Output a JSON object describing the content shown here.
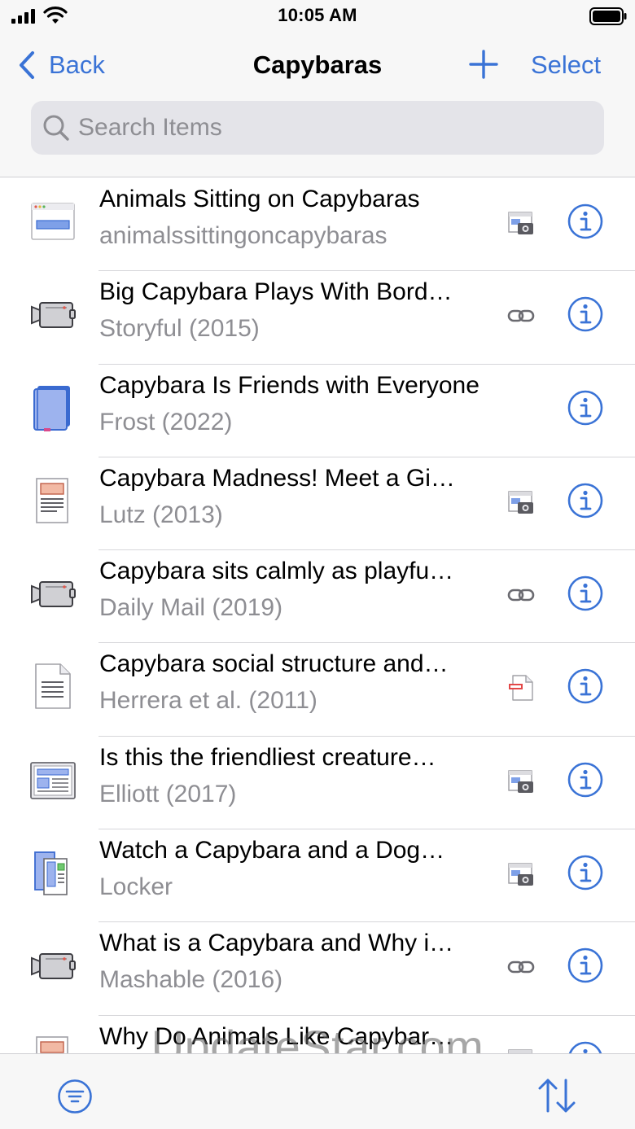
{
  "status_bar": {
    "time": "10:05 AM"
  },
  "nav": {
    "back_label": "Back",
    "title": "Capybaras",
    "select_label": "Select",
    "add_icon": "plus-icon"
  },
  "search": {
    "placeholder": "Search Items",
    "value": ""
  },
  "items": [
    {
      "title": "Animals Sitting on Capybaras",
      "subtitle": "animalssittingoncapybaras",
      "type_icon": "webpage-icon",
      "attachment_icon": "web-snapshot-icon"
    },
    {
      "title": "Big Capybara Plays With Bord…",
      "subtitle": "Storyful (2015)",
      "type_icon": "video-icon",
      "attachment_icon": "link-icon"
    },
    {
      "title": "Capybara Is Friends with Everyone",
      "subtitle": "Frost (2022)",
      "type_icon": "book-icon",
      "attachment_icon": ""
    },
    {
      "title": "Capybara Madness! Meet a Gi…",
      "subtitle": "Lutz (2013)",
      "type_icon": "magazine-article-icon",
      "attachment_icon": "web-snapshot-icon"
    },
    {
      "title": "Capybara sits calmly as playfu…",
      "subtitle": "Daily Mail (2019)",
      "type_icon": "video-icon",
      "attachment_icon": "link-icon"
    },
    {
      "title": "Capybara social structure and…",
      "subtitle": "Herrera et al. (2011)",
      "type_icon": "journal-article-icon",
      "attachment_icon": "pdf-icon"
    },
    {
      "title": "Is this the friendliest creature…",
      "subtitle": "Elliott (2017)",
      "type_icon": "newspaper-article-icon",
      "attachment_icon": "web-snapshot-icon"
    },
    {
      "title": "Watch a Capybara and a Dog…",
      "subtitle": "Locker",
      "type_icon": "blog-post-icon",
      "attachment_icon": "web-snapshot-icon"
    },
    {
      "title": "What is a Capybara and Why i…",
      "subtitle": "Mashable (2016)",
      "type_icon": "video-icon",
      "attachment_icon": "link-icon"
    },
    {
      "title": "Why Do Animals Like Capybar…",
      "subtitle": "",
      "type_icon": "magazine-article-icon",
      "attachment_icon": "web-snapshot-icon"
    }
  ],
  "toolbar": {
    "filter_icon": "filter-icon",
    "sort_icon": "sort-icon"
  },
  "watermark": "UpdateStar.com",
  "colors": {
    "accent": "#3a73d6",
    "secondary_text": "#8e8e93",
    "bar_background": "#f7f7f7",
    "search_field": "#e4e4e9"
  }
}
